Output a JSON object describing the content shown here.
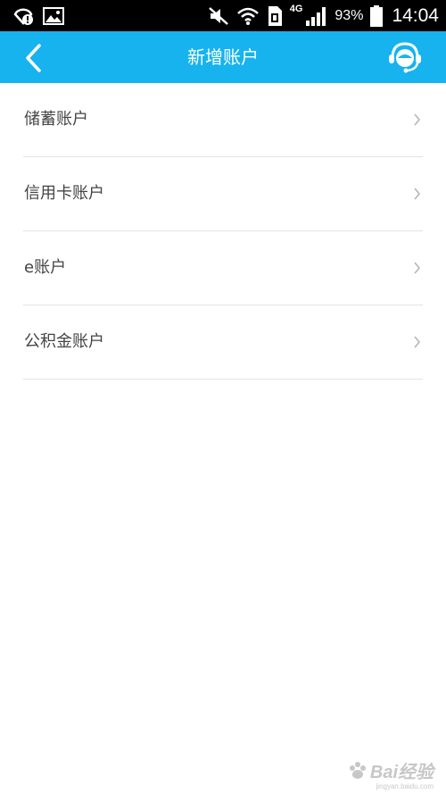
{
  "status_bar": {
    "battery_percent": "93%",
    "time": "14:04",
    "network": "4G",
    "icons": [
      "alert-badge-icon",
      "gallery-icon",
      "muted-icon",
      "wifi-icon",
      "sim-icon",
      "signal-icon",
      "battery-icon"
    ]
  },
  "header": {
    "title": "新增账户",
    "back_icon": "back-arrow-icon",
    "service_icon": "customer-service-icon",
    "color": "#16b3ef"
  },
  "menu": {
    "items": [
      {
        "label": "储蓄账户"
      },
      {
        "label": "信用卡账户"
      },
      {
        "label": "e账户"
      },
      {
        "label": "公积金账户"
      }
    ],
    "chevron_icon": "chevron-right-icon"
  },
  "watermark": {
    "text": "Bai经验",
    "url_text": "jingyan.baidu.com"
  }
}
